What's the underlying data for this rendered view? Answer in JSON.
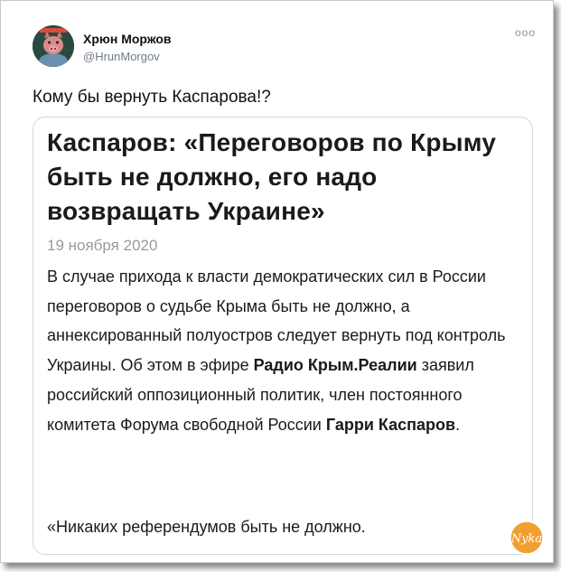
{
  "author": {
    "name": "Хрюн Моржов",
    "handle": "@HrunMorgov",
    "more_label": "ooo"
  },
  "tweet": {
    "text": "Кому бы вернуть Каспарова!?"
  },
  "card": {
    "headline": "Каспаров: «Переговоров по Крыму быть не должно, его надо возвращать Украине»",
    "date": "19 ноября 2020",
    "body": {
      "part1": "В случае прихода к власти демократических сил в России переговоров о судьбе Крыма быть не должно, а аннексированный полуостров следует вернуть под контроль Украины. Об этом в эфире ",
      "bold1": "Радио Крым.Реалии",
      "part2": " заявил российский оппозиционный политик, член постоянного комитета Форума свободной России ",
      "bold2": "Гарри Каспаров",
      "part3": "."
    },
    "quote": "«Никаких референдумов быть не должно."
  },
  "watermark": {
    "text": "Nyka",
    "color": "#f0a030"
  },
  "colors": {
    "name": "#111111",
    "handle": "#6e7b87",
    "card_border": "#cfd9de",
    "date": "#9a9a9a"
  }
}
